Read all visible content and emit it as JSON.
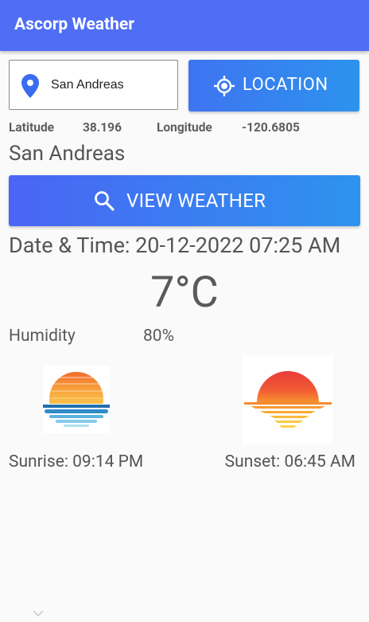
{
  "appbar": {
    "title": "Ascorp Weather",
    "color": "#4f6df5"
  },
  "search": {
    "value": "San Andreas",
    "icon": "location-pin-icon"
  },
  "location_button": {
    "label": "LOCATION",
    "icon": "gps-target-icon"
  },
  "coordinates": {
    "latitude_label": "Latitude",
    "latitude_value": "38.196",
    "longitude_label": "Longitude",
    "longitude_value": "-120.6805"
  },
  "city": "San Andreas",
  "view_button": {
    "label": "VIEW WEATHER",
    "icon": "search-icon"
  },
  "datetime": "Date & Time: 20-12-2022 07:25 AM",
  "temperature": "7°C",
  "humidity": {
    "label": "Humidity",
    "value": "80%"
  },
  "sunrise": {
    "text": "Sunrise: 09:14 PM",
    "icon": "sunrise-image"
  },
  "sunset": {
    "text": "Sunset: 06:45 AM",
    "icon": "sunset-image"
  },
  "colors": {
    "accent_start": "#4a65f4",
    "accent_end": "#2d93ee",
    "pin": "#3a6cf0"
  }
}
